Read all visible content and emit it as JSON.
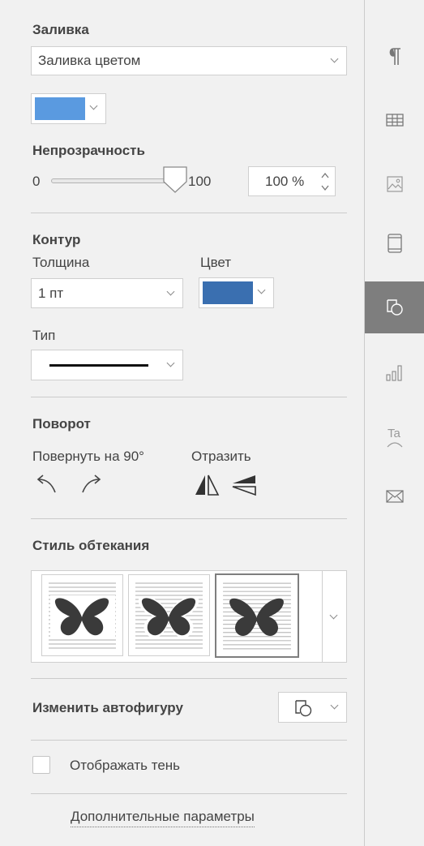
{
  "fill": {
    "title": "Заливка",
    "fill_type": "Заливка цветом",
    "color": "#5a9ae0",
    "opacity_label": "Непрозрачность",
    "slider_min": "0",
    "slider_max": "100",
    "opacity_value": "100 %",
    "opacity_level": 100
  },
  "outline": {
    "title": "Контур",
    "thickness_label": "Толщина",
    "thickness_value": "1 пт",
    "color_label": "Цвет",
    "color": "#3a6fb0",
    "type_label": "Тип"
  },
  "rotation": {
    "title": "Поворот",
    "rotate_label": "Повернуть на 90°",
    "flip_label": "Отразить"
  },
  "wrap": {
    "title": "Стиль обтекания",
    "selected_index": 2
  },
  "change_shape": {
    "label": "Изменить автофигуру"
  },
  "shadow": {
    "label": "Отображать тень",
    "checked": false
  },
  "advanced": {
    "label": "Дополнительные параметры"
  },
  "sidebar": {
    "items": [
      {
        "icon": "paragraph-icon",
        "active": false
      },
      {
        "icon": "table-icon",
        "active": false
      },
      {
        "icon": "image-icon",
        "active": false
      },
      {
        "icon": "header-footer-icon",
        "active": false
      },
      {
        "icon": "shape-icon",
        "active": true
      },
      {
        "icon": "chart-icon",
        "active": false
      },
      {
        "icon": "textart-icon",
        "active": false
      },
      {
        "icon": "mail-merge-icon",
        "active": false
      }
    ]
  },
  "colors": {
    "accent_active": "#7e7e7e",
    "panel_bg": "#f1f1f1",
    "border": "#cfcfcf"
  }
}
